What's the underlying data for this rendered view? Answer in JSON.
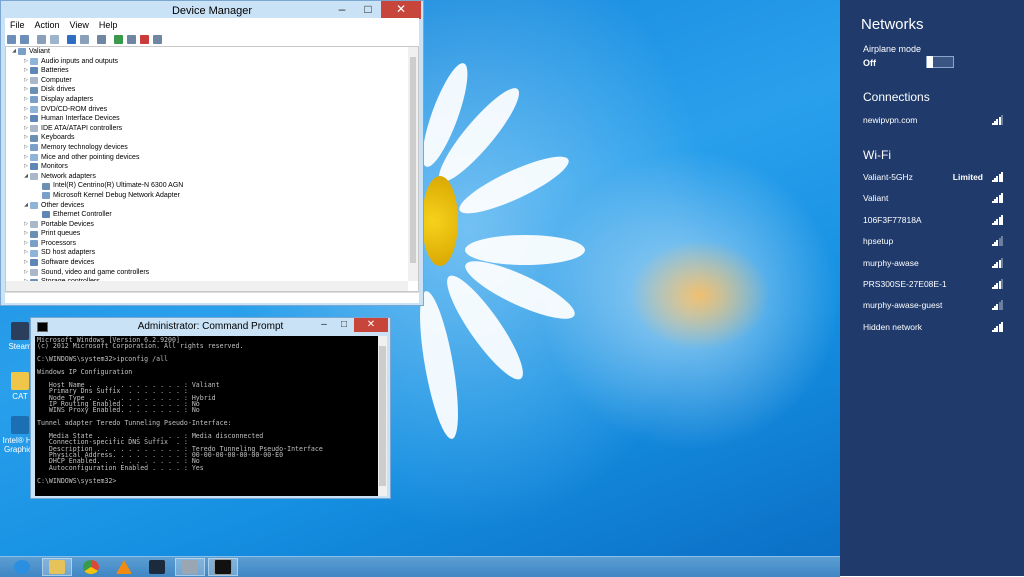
{
  "device_manager": {
    "title": "Device Manager",
    "menu": [
      "File",
      "Action",
      "View",
      "Help"
    ],
    "tree": [
      {
        "label": "Valiant",
        "level": 0,
        "expand": "open"
      },
      {
        "label": "Audio inputs and outputs",
        "level": 1,
        "expand": "closed"
      },
      {
        "label": "Batteries",
        "level": 1,
        "expand": "closed"
      },
      {
        "label": "Computer",
        "level": 1,
        "expand": "closed"
      },
      {
        "label": "Disk drives",
        "level": 1,
        "expand": "closed"
      },
      {
        "label": "Display adapters",
        "level": 1,
        "expand": "closed"
      },
      {
        "label": "DVD/CD-ROM drives",
        "level": 1,
        "expand": "closed"
      },
      {
        "label": "Human Interface Devices",
        "level": 1,
        "expand": "closed"
      },
      {
        "label": "IDE ATA/ATAPI controllers",
        "level": 1,
        "expand": "closed"
      },
      {
        "label": "Keyboards",
        "level": 1,
        "expand": "closed"
      },
      {
        "label": "Memory technology devices",
        "level": 1,
        "expand": "closed"
      },
      {
        "label": "Mice and other pointing devices",
        "level": 1,
        "expand": "closed"
      },
      {
        "label": "Monitors",
        "level": 1,
        "expand": "closed"
      },
      {
        "label": "Network adapters",
        "level": 1,
        "expand": "open"
      },
      {
        "label": "Intel(R) Centrino(R) Ultimate-N 6300 AGN",
        "level": 2,
        "expand": "none"
      },
      {
        "label": "Microsoft Kernel Debug Network Adapter",
        "level": 2,
        "expand": "none"
      },
      {
        "label": "Other devices",
        "level": 1,
        "expand": "open"
      },
      {
        "label": "Ethernet Controller",
        "level": 2,
        "expand": "none"
      },
      {
        "label": "Portable Devices",
        "level": 1,
        "expand": "closed"
      },
      {
        "label": "Print queues",
        "level": 1,
        "expand": "closed"
      },
      {
        "label": "Processors",
        "level": 1,
        "expand": "closed"
      },
      {
        "label": "SD host adapters",
        "level": 1,
        "expand": "closed"
      },
      {
        "label": "Software devices",
        "level": 1,
        "expand": "closed"
      },
      {
        "label": "Sound, video and game controllers",
        "level": 1,
        "expand": "closed"
      },
      {
        "label": "Storage controllers",
        "level": 1,
        "expand": "closed"
      }
    ]
  },
  "cmd": {
    "title": "Administrator: Command Prompt",
    "lines": [
      "Microsoft Windows [Version 6.2.9200]",
      "(c) 2012 Microsoft Corporation. All rights reserved.",
      "",
      "C:\\WINDOWS\\system32>ipconfig /all",
      "",
      "Windows IP Configuration",
      "",
      "   Host Name . . . . . . . . . . . . : Valiant",
      "   Primary Dns Suffix  . . . . . . . :",
      "   Node Type . . . . . . . . . . . . : Hybrid",
      "   IP Routing Enabled. . . . . . . . : No",
      "   WINS Proxy Enabled. . . . . . . . : No",
      "",
      "Tunnel adapter Teredo Tunneling Pseudo-Interface:",
      "",
      "   Media State . . . . . . . . . . . : Media disconnected",
      "   Connection-specific DNS Suffix  . :",
      "   Description . . . . . . . . . . . : Teredo Tunneling Pseudo-Interface",
      "   Physical Address. . . . . . . . . : 00-00-00-00-00-00-00-E0",
      "   DHCP Enabled. . . . . . . . . . . : No",
      "   Autoconfiguration Enabled . . . . : Yes",
      "",
      "C:\\WINDOWS\\system32>"
    ]
  },
  "desktop_icons": [
    {
      "label": "Steam"
    },
    {
      "label": "CAT"
    },
    {
      "label": "Intel® HD Graphics"
    }
  ],
  "taskbar": {
    "items": [
      {
        "name": "internet-explorer",
        "color": "#2a8fe0"
      },
      {
        "name": "file-explorer",
        "color": "#e6c25a"
      },
      {
        "name": "chrome",
        "color": "#d9493b"
      },
      {
        "name": "vlc",
        "color": "#f08a12"
      },
      {
        "name": "media-player",
        "color": "#1b2a3c"
      },
      {
        "name": "device-manager",
        "color": "#9aa6b2"
      },
      {
        "name": "command-prompt",
        "color": "#111111"
      }
    ]
  },
  "networks": {
    "title": "Networks",
    "airplane_label": "Airplane mode",
    "airplane_state": "Off",
    "connections_header": "Connections",
    "connections": [
      {
        "name": "newipvpn.com",
        "signal": 4
      }
    ],
    "wifi_header": "Wi-Fi",
    "wifi": [
      {
        "name": "Valiant-5GHz",
        "state": "Limited",
        "signal": 5
      },
      {
        "name": "Valiant",
        "state": "",
        "signal": 5
      },
      {
        "name": "106F3F77818A",
        "state": "",
        "signal": 5
      },
      {
        "name": "hpsetup",
        "state": "",
        "signal": 3
      },
      {
        "name": "murphy-awase",
        "state": "",
        "signal": 4
      },
      {
        "name": "PRS300SE-27E08E-1",
        "state": "",
        "signal": 4
      },
      {
        "name": "murphy-awase-guest",
        "state": "",
        "signal": 3
      },
      {
        "name": "Hidden network",
        "state": "",
        "signal": 5
      }
    ]
  }
}
